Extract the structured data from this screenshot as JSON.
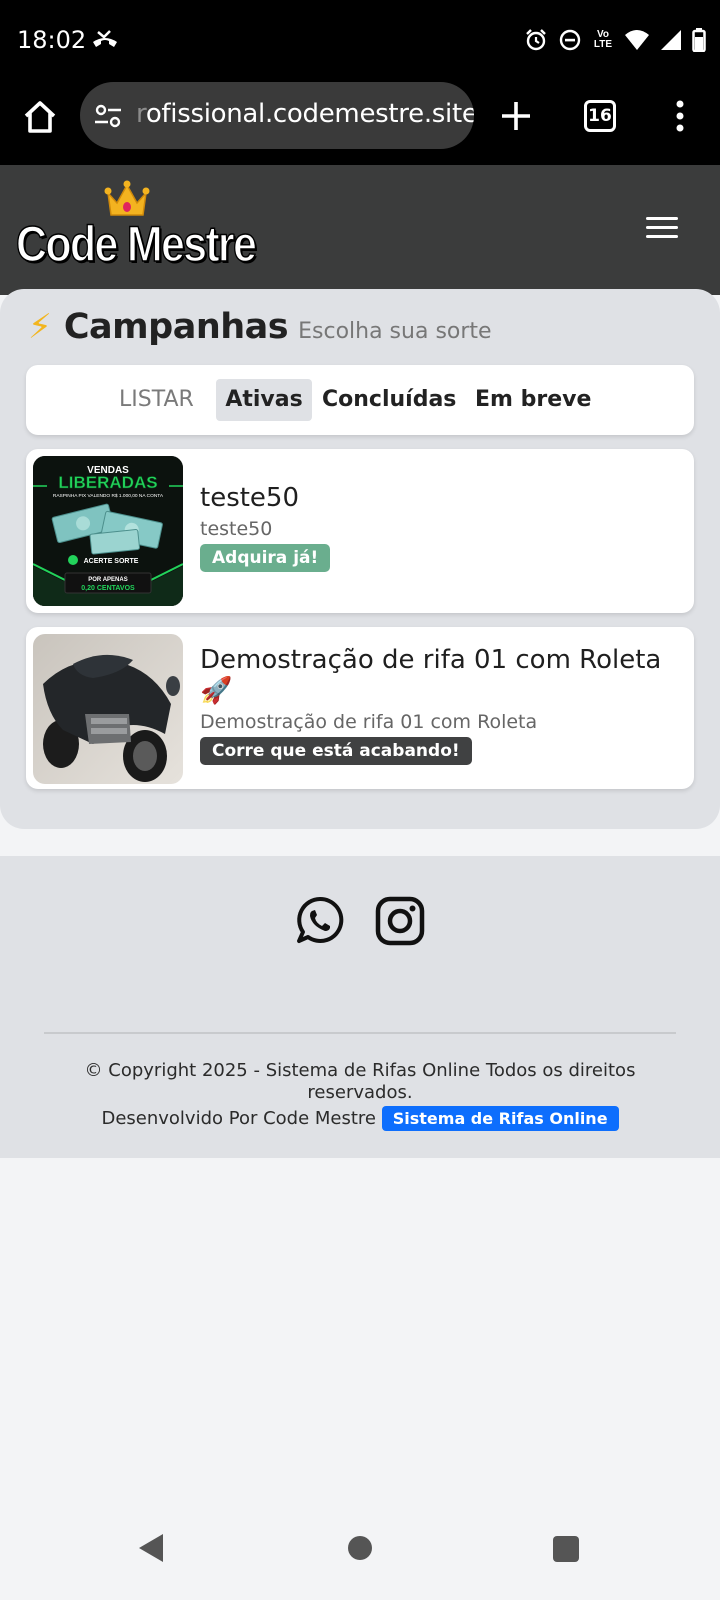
{
  "status_bar": {
    "time": "18:02",
    "icons": [
      "missed-call-icon",
      "alarm-icon",
      "do-not-disturb-icon",
      "volte-icon",
      "wifi-icon",
      "signal-icon",
      "battery-icon"
    ],
    "volte_label": "Vo LTE"
  },
  "browser": {
    "url_visible": "rofissional.codemestre.site",
    "url_faded_prefix": "r",
    "url_rest": "ofissional.codemestre.site",
    "tab_count": "16"
  },
  "site": {
    "logo_text": "Code Mestre"
  },
  "campaigns": {
    "title": "Campanhas",
    "subtitle": "Escolha sua sorte",
    "filters": {
      "label": "LISTAR",
      "active": "Ativas",
      "completed": "Concluídas",
      "soon": "Em breve"
    },
    "items": [
      {
        "title": "teste50",
        "subtitle": "teste50",
        "badge": "Adquira já!",
        "thumb_text": {
          "line1": "VENDAS",
          "line2": "LIBERADAS",
          "line3": "RASPINHA PIX VALENDO R$ 1.000,00 NA CONTA",
          "brand": "ACERTE SORTE",
          "line4": "POR APENAS",
          "line5": "0,20 CENTAVOS"
        }
      },
      {
        "title": "Demostração de rifa 01 com Roleta 🚀",
        "subtitle": "Demostração de rifa 01 com Roleta",
        "badge": "Corre que está acabando!"
      }
    ]
  },
  "footer": {
    "copyright": "© Copyright 2025 - Sistema de Rifas Online Todos os direitos reservados.",
    "developed_by": "Desenvolvido Por Code Mestre",
    "developer_link": "Sistema de Rifas Online"
  },
  "colors": {
    "header_bg": "#3b3c3c",
    "section_bg": "#dfe1e5",
    "badge_green": "#6aae8e",
    "badge_dark": "#404142",
    "link_blue": "#0d6efd",
    "bolt": "#f2b51f"
  }
}
